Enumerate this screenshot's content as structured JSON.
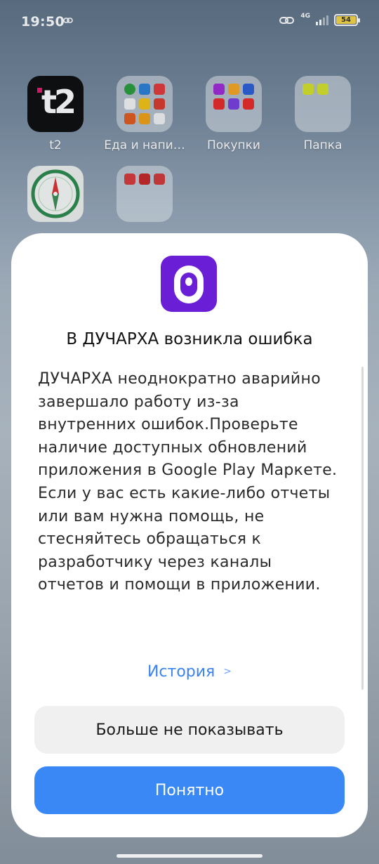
{
  "status_bar": {
    "time": "19:50",
    "network": "4G",
    "battery": "54"
  },
  "home": {
    "apps": [
      {
        "label": "t2",
        "icon": "t2-app-icon"
      },
      {
        "label": "Еда и напи…",
        "icon": "food-folder-icon"
      },
      {
        "label": "Покупки",
        "icon": "shopping-folder-icon"
      },
      {
        "label": "Папка",
        "icon": "folder-icon"
      },
      {
        "label": "",
        "icon": "compass-app-icon"
      },
      {
        "label": "",
        "icon": "health-folder-icon"
      }
    ]
  },
  "dialog": {
    "title": "В ДУЧАРХА возникла ошибка",
    "message": "ДУЧАРХА неоднократно аварийно завершало работу из-за внутренних ошибок.Проверьте наличие доступных обновлений приложения в Google Play Маркете. Если у вас есть какие-либо отчеты или вам нужна помощь, не стесняйтесь обращаться к разработчику через каналы отчетов и помощи в приложении.",
    "history_link": "История",
    "dont_show_button": "Больше не показывать",
    "ok_button": "Понятно",
    "app_icon_color": "#6a1fd6",
    "accent_color": "#3a88f5"
  }
}
